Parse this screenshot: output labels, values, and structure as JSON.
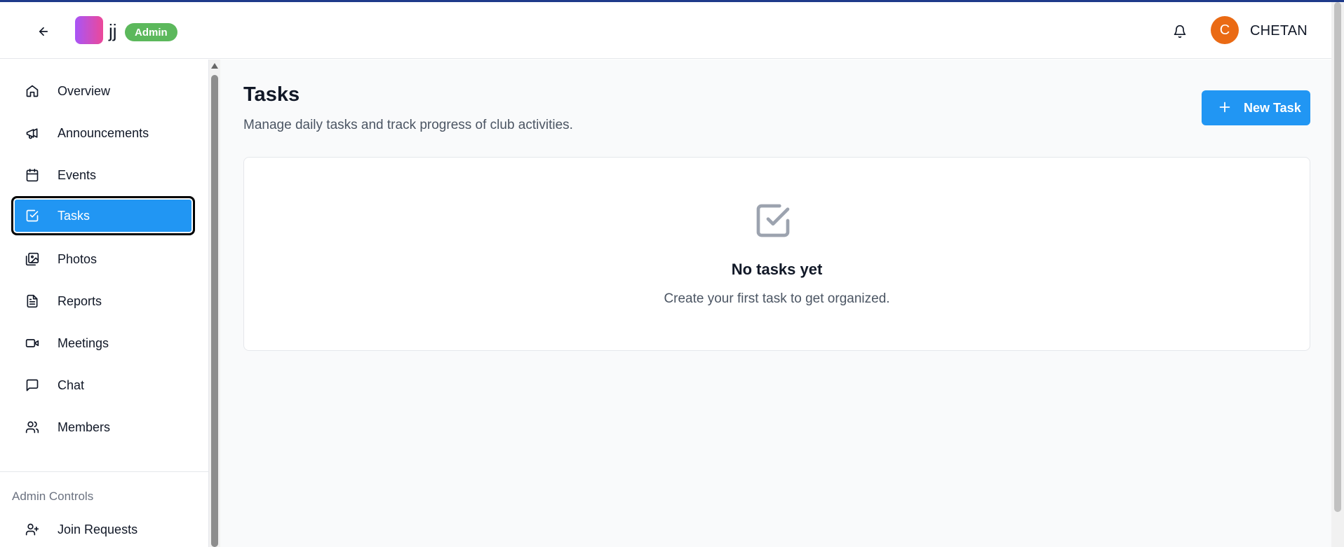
{
  "header": {
    "back_icon": "arrow-left-icon",
    "club_name": "jj",
    "role_badge": "Admin",
    "notification_icon": "bell-icon",
    "user_initial": "C",
    "user_name": "CHETAN",
    "avatar_color": "#ea6a14"
  },
  "sidebar": {
    "items": [
      {
        "label": "Overview",
        "icon": "home-icon"
      },
      {
        "label": "Announcements",
        "icon": "megaphone-icon"
      },
      {
        "label": "Events",
        "icon": "calendar-icon"
      },
      {
        "label": "Tasks",
        "icon": "check-square-icon",
        "active": true
      },
      {
        "label": "Photos",
        "icon": "images-icon"
      },
      {
        "label": "Reports",
        "icon": "file-text-icon"
      },
      {
        "label": "Meetings",
        "icon": "video-icon"
      },
      {
        "label": "Chat",
        "icon": "message-square-icon"
      },
      {
        "label": "Members",
        "icon": "users-icon"
      }
    ],
    "admin_section_label": "Admin Controls",
    "admin_items": [
      {
        "label": "Join Requests",
        "icon": "user-plus-icon"
      }
    ]
  },
  "main": {
    "title": "Tasks",
    "subtitle": "Manage daily tasks and track progress of club activities.",
    "new_task_label": "New Task",
    "empty_state": {
      "icon": "check-square-icon",
      "title": "No tasks yet",
      "description": "Create your first task to get organized."
    }
  },
  "colors": {
    "accent": "#2196f3",
    "admin_badge": "#5cb85c",
    "top_bar": "#1e3a8a"
  }
}
